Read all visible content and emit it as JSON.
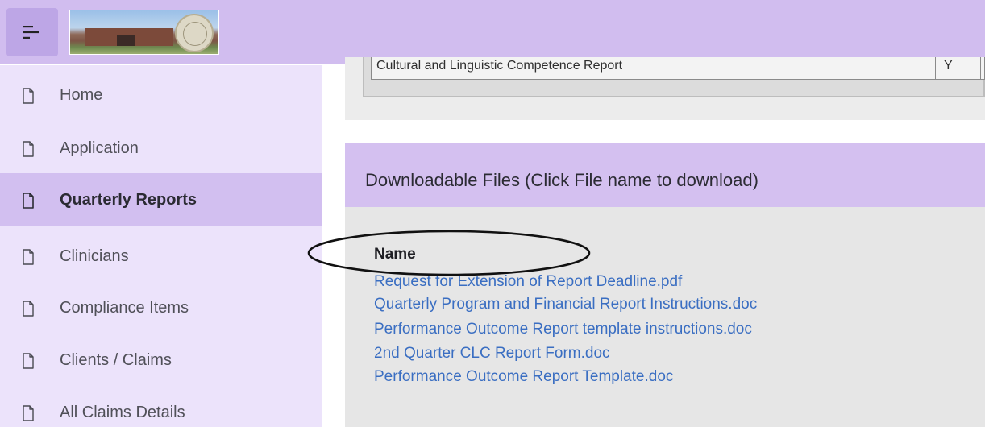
{
  "header": {
    "menu_icon": "hamburger-menu-icon",
    "logo_alt": "building-photo-with-seal-logo"
  },
  "sidebar": {
    "items": [
      {
        "label": "Home",
        "icon": "page-icon",
        "active": false
      },
      {
        "label": "Application",
        "icon": "page-icon",
        "active": false
      },
      {
        "label": "Quarterly Reports",
        "icon": "page-icon",
        "active": true
      },
      {
        "label": "Clinicians",
        "icon": "page-icon",
        "active": false
      },
      {
        "label": "Compliance Items",
        "icon": "page-icon",
        "active": false
      },
      {
        "label": "Clients / Claims",
        "icon": "page-icon",
        "active": false
      },
      {
        "label": "All Claims Details",
        "icon": "page-icon",
        "active": false
      }
    ]
  },
  "reports_table": {
    "row": {
      "name": "Cultural and Linguistic Competence Report",
      "col2": "",
      "col3": "Y"
    }
  },
  "downloads": {
    "title": "Downloadable Files (Click File name to download)",
    "column_header": "Name",
    "files": [
      "Request for Extension of Report Deadline.pdf",
      "Quarterly Program and Financial Report Instructions.doc",
      "Performance Outcome Report template instructions.doc",
      "2nd Quarter CLC Report Form.doc",
      "Performance Outcome Report Template.doc"
    ],
    "highlighted_file": "Quarterly Program and Financial Report Instructions.doc"
  },
  "colors": {
    "topbar": "#d1bdef",
    "sidebar": "#ece3fb",
    "active_nav": "#d2bff0",
    "link": "#3a6ec2"
  }
}
